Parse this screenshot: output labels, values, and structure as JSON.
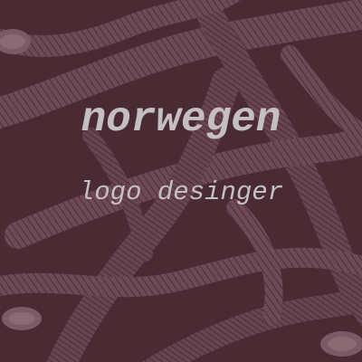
{
  "logo": {
    "title": "norwegen",
    "subtitle": "logo desinger"
  },
  "colors": {
    "background": "#4a2a33",
    "stroke": "#6e4a55",
    "text": "#c4c0c2"
  }
}
